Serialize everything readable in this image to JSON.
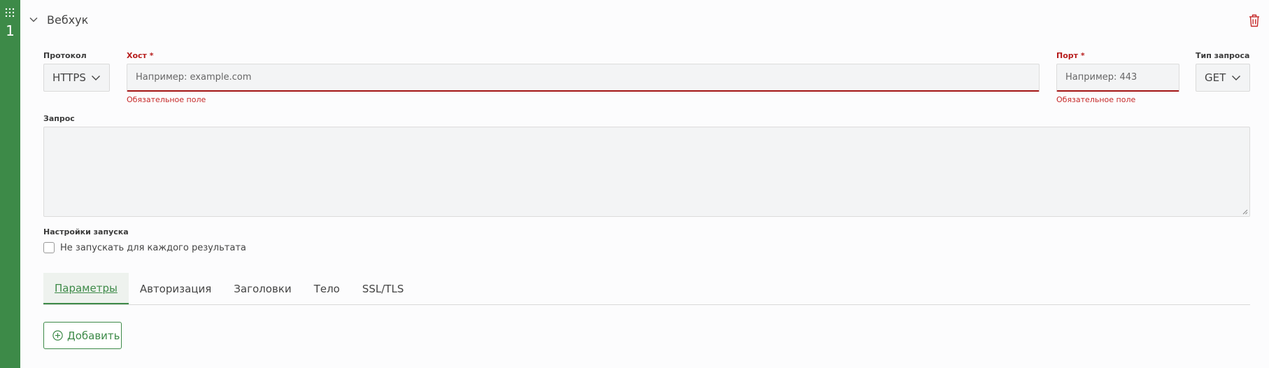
{
  "rail": {
    "number": "1"
  },
  "header": {
    "title": "Вебхук"
  },
  "form": {
    "protocol": {
      "label": "Протокол",
      "value": "HTTPS"
    },
    "host": {
      "label": "Хост *",
      "placeholder": "Например: example.com",
      "error": "Обязательное поле"
    },
    "port": {
      "label": "Порт *",
      "placeholder": "Например: 443",
      "error": "Обязательное поле"
    },
    "method": {
      "label": "Тип запроса",
      "value": "GET"
    },
    "request": {
      "label": "Запрос"
    },
    "run_settings": {
      "label": "Настройки запуска",
      "checkbox_label": "Не запускать для каждого результата",
      "checked": false
    }
  },
  "tabs": [
    {
      "label": "Параметры",
      "active": true
    },
    {
      "label": "Авторизация",
      "active": false
    },
    {
      "label": "Заголовки",
      "active": false
    },
    {
      "label": "Тело",
      "active": false
    },
    {
      "label": "SSL/TLS",
      "active": false
    }
  ],
  "add_button": {
    "label": "Добавить"
  },
  "colors": {
    "accent": "#3d8a48",
    "error": "#b71c1c"
  },
  "icons": [
    "drag-grip-icon",
    "chevron-down-icon",
    "trash-icon",
    "plus-circle-icon",
    "resize-handle-icon"
  ]
}
